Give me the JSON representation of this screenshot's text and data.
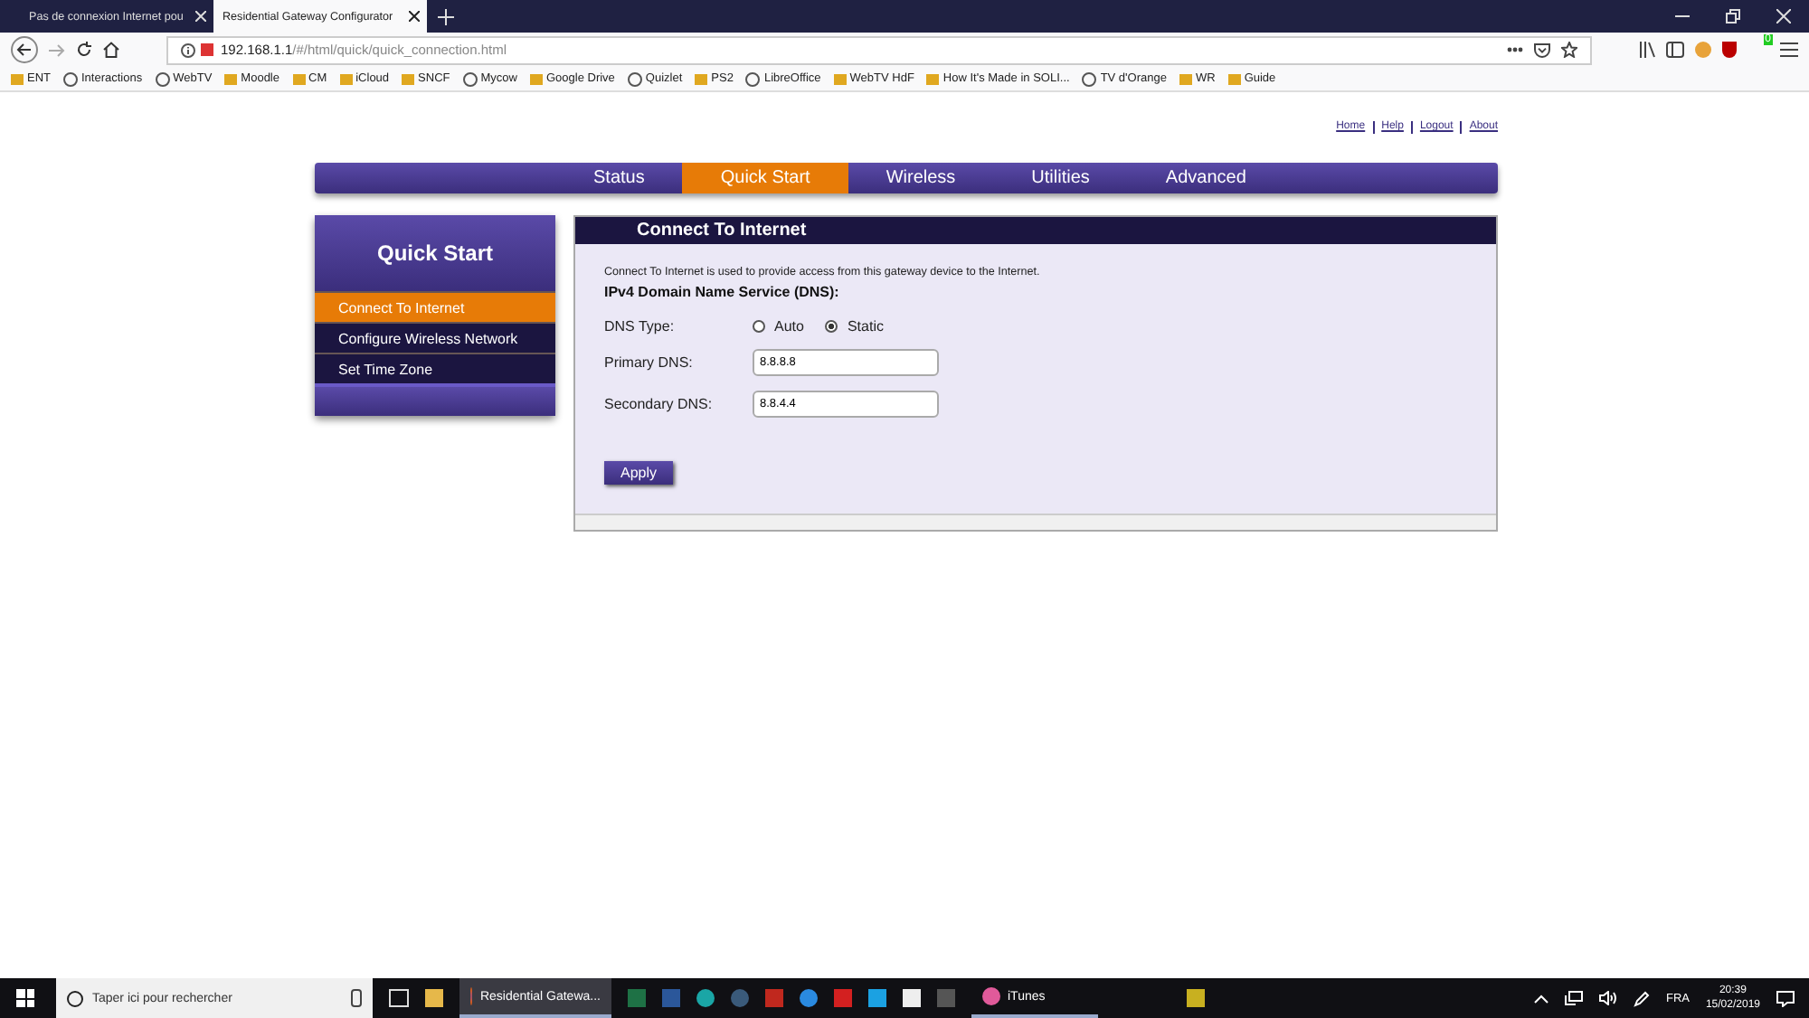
{
  "browser": {
    "tabs": [
      {
        "title": "Pas de connexion Internet pou",
        "selected": false
      },
      {
        "title": "Residential Gateway Configurator",
        "selected": true
      }
    ],
    "url": {
      "host": "192.168.1.1",
      "path": "/#/html/quick/quick_connection.html"
    },
    "bookmarks": [
      {
        "label": "ENT",
        "kind": "tile"
      },
      {
        "label": "Interactions",
        "kind": "globe"
      },
      {
        "label": "WebTV",
        "kind": "globe"
      },
      {
        "label": "Moodle",
        "kind": "tile"
      },
      {
        "label": "CM",
        "kind": "tile"
      },
      {
        "label": "iCloud",
        "kind": "tile"
      },
      {
        "label": "SNCF",
        "kind": "tile"
      },
      {
        "label": "Mycow",
        "kind": "globe"
      },
      {
        "label": "Google Drive",
        "kind": "tile"
      },
      {
        "label": "Quizlet",
        "kind": "globe"
      },
      {
        "label": "PS2",
        "kind": "tile"
      },
      {
        "label": "LibreOffice",
        "kind": "globe"
      },
      {
        "label": "WebTV HdF",
        "kind": "tile"
      },
      {
        "label": "How It's Made in SOLI...",
        "kind": "tile"
      },
      {
        "label": "TV d'Orange",
        "kind": "globe"
      },
      {
        "label": "WR",
        "kind": "tile"
      },
      {
        "label": "Guide",
        "kind": "tile"
      }
    ],
    "badge": "0"
  },
  "page": {
    "top_links": [
      "Home",
      "Help",
      "Logout",
      "About"
    ],
    "nav": [
      {
        "label": "Status",
        "selected": false
      },
      {
        "label": "Quick Start",
        "selected": true
      },
      {
        "label": "Wireless",
        "selected": false
      },
      {
        "label": "Utilities",
        "selected": false
      },
      {
        "label": "Advanced",
        "selected": false
      }
    ],
    "sidebar": {
      "title": "Quick Start",
      "items": [
        {
          "label": "Connect To Internet",
          "selected": true
        },
        {
          "label": "Configure Wireless Network",
          "selected": false
        },
        {
          "label": "Set Time Zone",
          "selected": false
        }
      ]
    },
    "panel": {
      "title": "Connect To Internet",
      "description": "Connect To Internet is used to provide access from this gateway device to the Internet.",
      "heading": "IPv4 Domain Name Service (DNS):",
      "dns_type": {
        "label": "DNS Type:",
        "options": [
          {
            "label": "Auto",
            "selected": false
          },
          {
            "label": "Static",
            "selected": true
          }
        ]
      },
      "fields": [
        {
          "label": "Primary DNS:",
          "value": "8.8.8.8"
        },
        {
          "label": "Secondary DNS:",
          "value": "8.8.4.4"
        }
      ],
      "apply": "Apply"
    }
  },
  "taskbar": {
    "search": {
      "placeholder": "Taper ici pour rechercher"
    },
    "apps": [
      {
        "label": "Residential Gatewa...",
        "selected": true
      },
      {
        "label": "iTunes",
        "selected": false
      }
    ],
    "language": "FRA",
    "time": "20:39",
    "date": "15/02/2019"
  }
}
